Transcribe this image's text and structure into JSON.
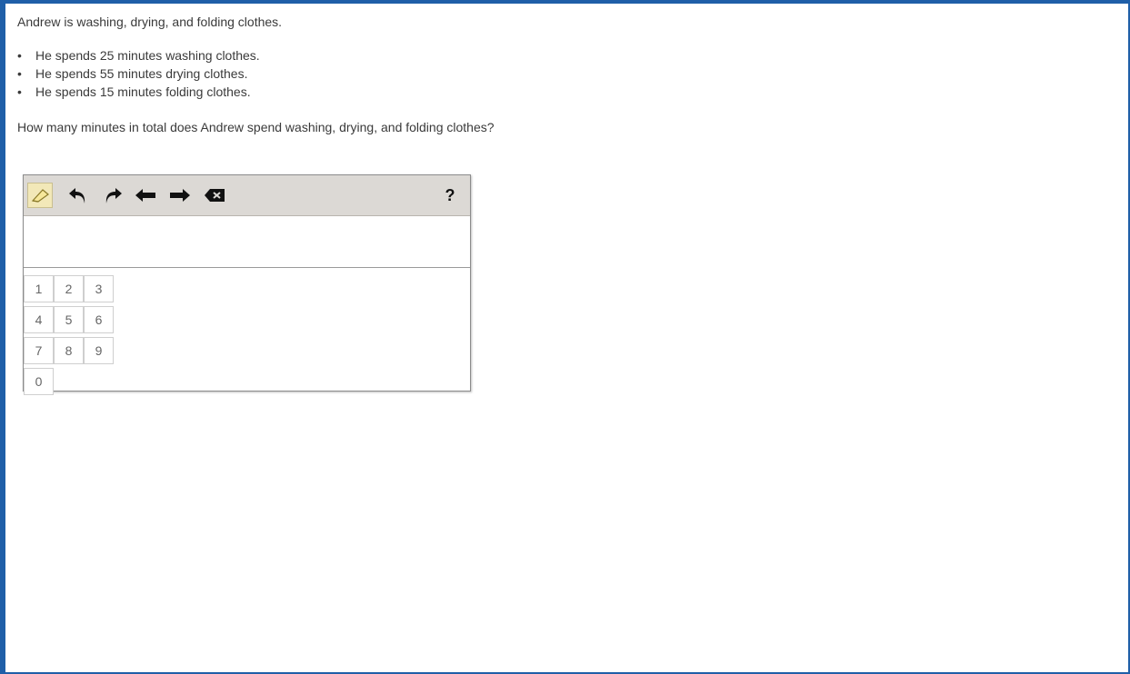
{
  "question": {
    "intro": "Andrew is washing, drying, and folding clothes.",
    "bullets": [
      "He spends 25 minutes washing clothes.",
      "He spends 55 minutes drying clothes.",
      "He spends 15 minutes folding clothes."
    ],
    "prompt": "How many minutes in total does Andrew spend washing, drying, and folding clothes?"
  },
  "toolbar": {
    "icons": [
      "eraser-icon",
      "undo-icon",
      "redo-icon",
      "arrow-left-icon",
      "arrow-right-icon",
      "backspace-icon"
    ],
    "help_label": "?"
  },
  "answer": {
    "value": ""
  },
  "keypad": {
    "keys": [
      "1",
      "2",
      "3",
      "4",
      "5",
      "6",
      "7",
      "8",
      "9",
      "0"
    ]
  },
  "colors": {
    "frame_border": "#1f5fa8",
    "toolbar_bg": "#dcd9d5"
  }
}
